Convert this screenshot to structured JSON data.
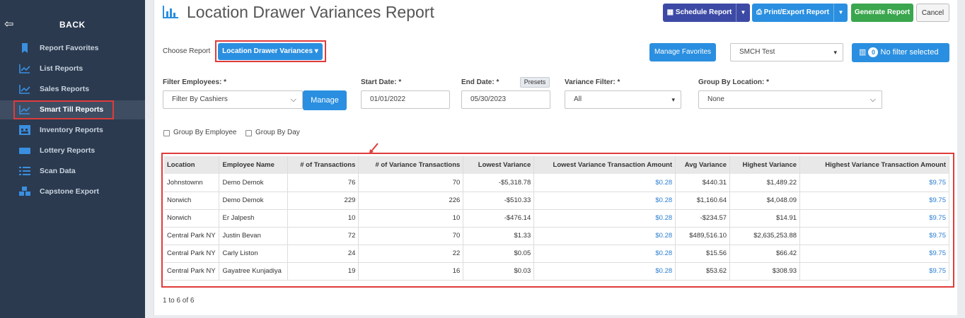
{
  "sidebar": {
    "back_label": "BACK",
    "items": [
      {
        "label": "Report Favorites",
        "icon": "bookmark-icon"
      },
      {
        "label": "List Reports",
        "icon": "line-chart-icon"
      },
      {
        "label": "Sales Reports",
        "icon": "line-chart-icon"
      },
      {
        "label": "Smart Till Reports",
        "icon": "line-chart-icon"
      },
      {
        "label": "Inventory Reports",
        "icon": "warehouse-icon"
      },
      {
        "label": "Lottery Reports",
        "icon": "ticket-icon"
      },
      {
        "label": "Scan Data",
        "icon": "list-icon"
      },
      {
        "label": "Capstone Export",
        "icon": "cubes-icon"
      }
    ]
  },
  "header": {
    "title": "Location Drawer Variances Report",
    "schedule_label": "Schedule Report",
    "print_label": "Print/Export Report",
    "generate_label": "Generate Report",
    "cancel_label": "Cancel"
  },
  "choose": {
    "label": "Choose Report",
    "selected": "Location Drawer Variances",
    "manage_favorites": "Manage Favorites",
    "store": "SMCH Test",
    "filter_count": "0",
    "filter_text": "No filter selected"
  },
  "filters": {
    "employees_label": "Filter Employees: *",
    "employees_value": "Filter By Cashiers",
    "manage_label": "Manage",
    "start_label": "Start Date: *",
    "start_value": "01/01/2022",
    "end_label": "End Date: *",
    "end_value": "05/30/2023",
    "presets_label": "Presets",
    "variance_label": "Variance Filter: *",
    "variance_value": "All",
    "group_location_label": "Group By Location: *",
    "group_location_value": "None",
    "group_employee_label": "Group By Employee",
    "group_day_label": "Group By Day"
  },
  "table": {
    "headers": [
      "Location",
      "Employee Name",
      "# of Transactions",
      "# of Variance Transactions",
      "Lowest Variance",
      "Lowest Variance Transaction Amount",
      "Avg Variance",
      "Highest Variance",
      "Highest Variance Transaction Amount"
    ],
    "rows": [
      [
        "Johnstownn",
        "Demo Demok",
        "76",
        "70",
        "-$5,318.78",
        "$0.28",
        "$440.31",
        "$1,489.22",
        "$9.75"
      ],
      [
        "Norwich",
        "Demo Demok",
        "229",
        "226",
        "-$510.33",
        "$0.28",
        "$1,160.64",
        "$4,048.09",
        "$9.75"
      ],
      [
        "Norwich",
        "Er Jalpesh",
        "10",
        "10",
        "-$476.14",
        "$0.28",
        "-$234.57",
        "$14.91",
        "$9.75"
      ],
      [
        "Central Park NY",
        "Justin Bevan",
        "72",
        "70",
        "$1.33",
        "$0.28",
        "$489,516.10",
        "$2,635,253.88",
        "$9.75"
      ],
      [
        "Central Park NY",
        "Carly Liston",
        "24",
        "22",
        "$0.05",
        "$0.28",
        "$15.56",
        "$66.42",
        "$9.75"
      ],
      [
        "Central Park NY",
        "Gayatree Kunjadiya",
        "19",
        "16",
        "$0.03",
        "$0.28",
        "$53.62",
        "$308.93",
        "$9.75"
      ]
    ]
  },
  "pager": "1 to 6 of 6",
  "colors": {
    "sidebar": "#2b3a4f",
    "accent": "#2a8fe0",
    "highlight": "#e03b3b"
  }
}
